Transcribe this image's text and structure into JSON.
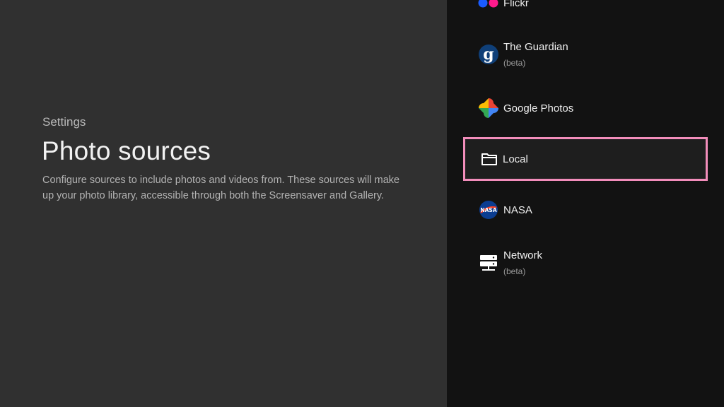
{
  "left": {
    "breadcrumb": "Settings",
    "title": "Photo sources",
    "description": "Configure sources to include photos and videos from. These sources will make up your photo library, accessible through both the Screensaver and Gallery."
  },
  "sources": [
    {
      "label": "Flickr",
      "sublabel": "",
      "icon": "flickr-icon"
    },
    {
      "label": "The Guardian",
      "sublabel": "(beta)",
      "icon": "guardian-icon"
    },
    {
      "label": "Google Photos",
      "sublabel": "",
      "icon": "google-photos-icon"
    },
    {
      "label": "Local",
      "sublabel": "",
      "icon": "folder-icon",
      "focused": true
    },
    {
      "label": "NASA",
      "sublabel": "",
      "icon": "nasa-icon"
    },
    {
      "label": "Network",
      "sublabel": "(beta)",
      "icon": "network-icon"
    }
  ],
  "colors": {
    "focus_outline": "#f28dbb",
    "left_bg": "#303030",
    "right_bg": "#121212"
  }
}
